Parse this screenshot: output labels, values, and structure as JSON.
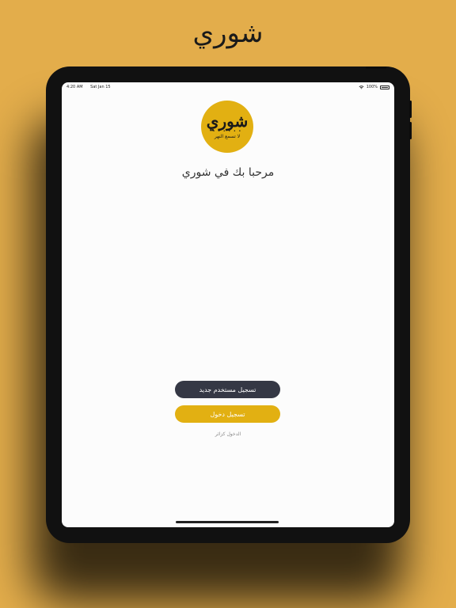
{
  "headline": "شوري",
  "status_bar": {
    "time": "4:20 AM",
    "date": "Sat Jan 15",
    "battery": "100%"
  },
  "logo": {
    "main_text": "شوري",
    "sub_text": "لا تسمع النهر"
  },
  "welcome_text": "مرحبا بك في شوري",
  "buttons": {
    "register_label": "تسجيل مستخدم جديد",
    "login_label": "تسجيل دخول",
    "guest_label": "الدخول كزائر"
  },
  "colors": {
    "background": "#e3ad4b",
    "accent": "#e2b012",
    "dark_button": "#353845"
  },
  "icons": {
    "wifi": "wifi-icon",
    "battery": "battery-icon"
  }
}
